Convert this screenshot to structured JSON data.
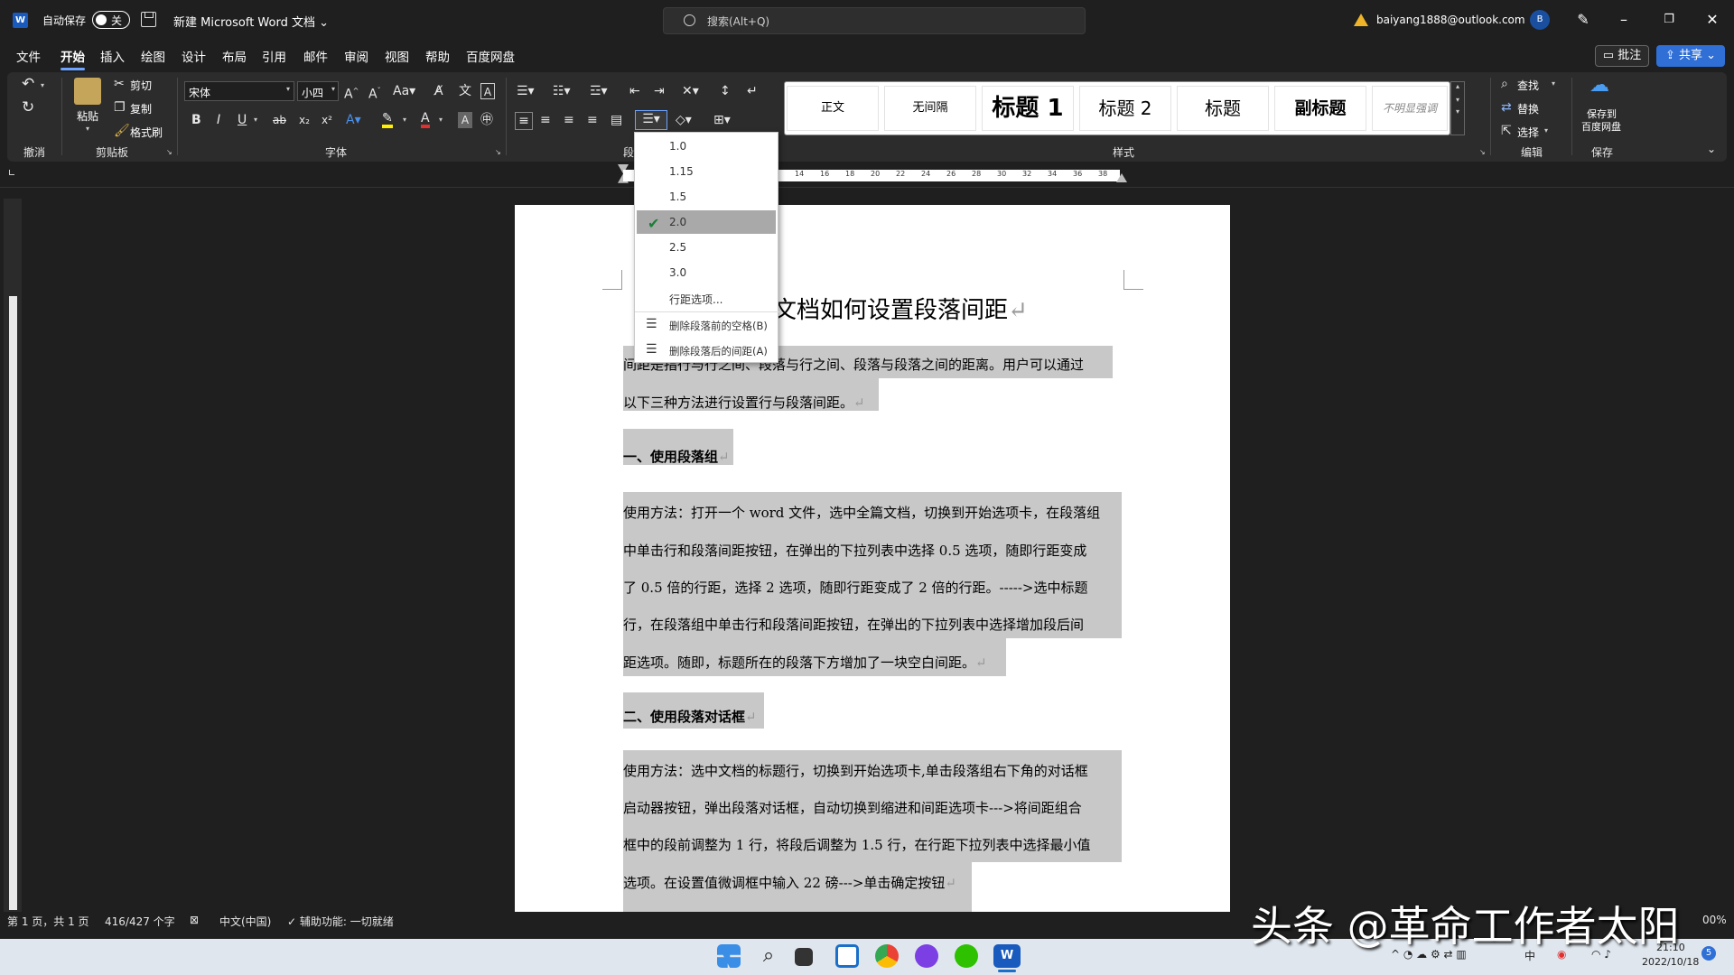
{
  "titlebar": {
    "autosave_label": "自动保存",
    "autosave_state": "关",
    "doc_title": "新建 Microsoft Word 文档",
    "search_placeholder": "搜索(Alt+Q)",
    "account": "baiyang1888@outlook.com",
    "avatar_initial": "B"
  },
  "tabs": [
    "文件",
    "开始",
    "插入",
    "绘图",
    "设计",
    "布局",
    "引用",
    "邮件",
    "审阅",
    "视图",
    "帮助",
    "百度网盘"
  ],
  "buttons": {
    "comment": "批注",
    "share": "共享"
  },
  "ribbon": {
    "clipboard": {
      "paste": "粘贴",
      "cut": "剪切",
      "copy": "复制",
      "format_painter": "格式刷",
      "group": "剪贴板"
    },
    "undo_group": "撤消",
    "font": {
      "name": "宋体",
      "size": "小四",
      "group": "字体"
    },
    "paragraph_group": "段",
    "styles": {
      "items": [
        "正文",
        "无间隔",
        "标题 1",
        "标题 2",
        "标题",
        "副标题",
        "不明显强调"
      ],
      "group": "样式"
    },
    "editing": {
      "find": "查找",
      "replace": "替换",
      "select": "选择",
      "group": "编辑"
    },
    "save": {
      "label1": "保存到",
      "label2": "百度网盘",
      "group": "保存"
    }
  },
  "ruler": {
    "numbers": [
      "14",
      "16",
      "18",
      "20",
      "22",
      "24",
      "26",
      "28",
      "30",
      "32",
      "34",
      "36",
      "38"
    ]
  },
  "line_spacing_menu": {
    "options": [
      "1.0",
      "1.15",
      "1.5",
      "2.0",
      "2.5",
      "3.0"
    ],
    "selected": "2.0",
    "line_options": "行距选项...",
    "remove_before": "删除段落前的空格(B)",
    "remove_after": "删除段落后的间距(A)"
  },
  "document": {
    "title": "文档如何设置段落间距",
    "p1_line1": "间距是指行与行之间、段落与行之间、段落与段落之间的距离。用户可以通过",
    "p1_line2": "以下三种方法进行设置行与段落间距。",
    "h1": "一、使用段落组",
    "m1": {
      "l1": "使用方法：打开一个 word 文件，选中全篇文档，切换到开始选项卡，在段落组",
      "l2": "中单击行和段落间距按钮，在弹出的下拉列表中选择 0.5 选项，随即行距变成",
      "l3": "了 0.5 倍的行距，选择 2 选项，随即行距变成了 2 倍的行距。----->选中标题",
      "l4": "行，在段落组中单击行和段落间距按钮，在弹出的下拉列表中选择增加段后间",
      "l5": "距选项。随即，标题所在的段落下方增加了一块空白间距。"
    },
    "h2": "二、使用段落对话框",
    "m2": {
      "l1": "使用方法：选中文档的标题行，切换到开始选项卡,单击段落组右下角的对话框",
      "l2": "启动器按钮，弹出段落对话框，自动切换到缩进和间距选项卡--->将间距组合",
      "l3": "框中的段前调整为 1 行，将段后调整为 1.5 行，在行距下拉列表中选择最小值",
      "l4": "选项。在设置值微调框中输入 22 磅--->单击确定按钮"
    }
  },
  "statusbar": {
    "page": "第 1 页，共 1 页",
    "words": "416/427 个字",
    "lang": "中文(中国)",
    "accessibility": "辅助功能: 一切就绪",
    "zoom": "00%"
  },
  "taskbar": {
    "ime": "中",
    "time": "21:10",
    "date": "2022/10/18",
    "badge": "5"
  },
  "watermark": "头条 @革命工作者太阳",
  "colors": {
    "accent": "#2f6fd6",
    "selection": "#c8c8c8",
    "check": "#1a7f37"
  }
}
